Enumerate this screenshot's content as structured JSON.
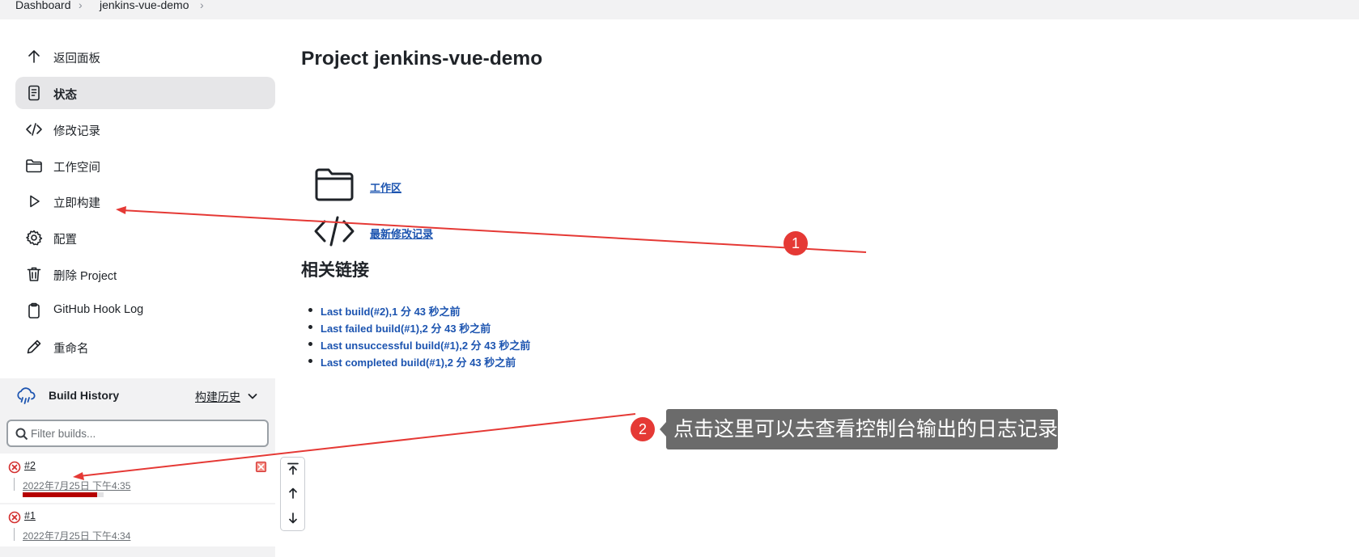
{
  "breadcrumb": {
    "dashboard": "Dashboard",
    "project": "jenkins-vue-demo",
    "separator": "›"
  },
  "sidebar": {
    "items": [
      {
        "label": "返回面板",
        "icon": "arrow-up-icon"
      },
      {
        "label": "状态",
        "icon": "document-icon",
        "active": true
      },
      {
        "label": "修改记录",
        "icon": "code-icon"
      },
      {
        "label": "工作空间",
        "icon": "folder-icon"
      },
      {
        "label": "立即构建",
        "icon": "play-icon"
      },
      {
        "label": "配置",
        "icon": "gear-icon"
      },
      {
        "label": "删除 Project",
        "icon": "trash-icon"
      },
      {
        "label": "GitHub Hook Log",
        "icon": "clipboard-icon"
      },
      {
        "label": "重命名",
        "icon": "pencil-icon"
      }
    ]
  },
  "build_history": {
    "title": "Build History",
    "link": "构建历史",
    "filter_placeholder": "Filter builds...",
    "builds": [
      {
        "number": "#2",
        "date": "2022年7月25日 下午4:35",
        "status": "failed",
        "in_progress": true
      },
      {
        "number": "#1",
        "date": "2022年7月25日 下午4:34",
        "status": "failed"
      }
    ]
  },
  "main": {
    "title": "Project jenkins-vue-demo",
    "workspace_link": "工作区",
    "changes_link": "最新修改记录",
    "related_title": "相关链接",
    "related_links": [
      "Last build(#2),1 分 43 秒之前",
      "Last failed build(#1),2 分 43 秒之前",
      "Last unsuccessful build(#1),2 分 43 秒之前",
      "Last completed build(#1),2 分 43 秒之前"
    ]
  },
  "annotations": {
    "marker1": "1",
    "marker2": "2",
    "callout": "点击这里可以去查看控制台输出的日志记录",
    "color": "#e53935"
  },
  "colors": {
    "link": "#1c54b0",
    "active_bg": "#e6e6e8",
    "panel_bg": "#f2f2f3",
    "error": "#d32f2f"
  }
}
